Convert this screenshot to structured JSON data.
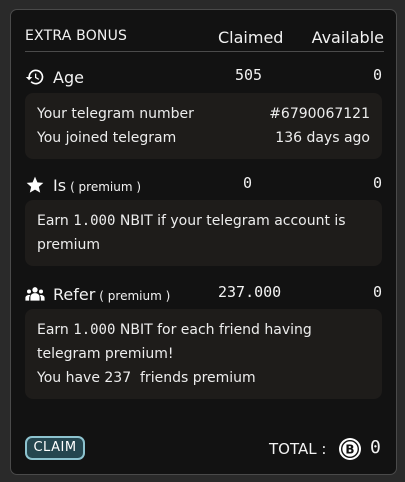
{
  "header": {
    "title": "EXTRA BONUS",
    "claimed_col": "Claimed",
    "available_col": "Available"
  },
  "sections": {
    "age": {
      "icon": "history-icon",
      "label": "Age",
      "claimed": "505",
      "available": "0",
      "rows": [
        {
          "label": "Your telegram number",
          "value": "#6790067121"
        },
        {
          "label": "You joined telegram",
          "value": "136 days ago"
        }
      ]
    },
    "premium": {
      "icon": "star-icon",
      "label": "Is",
      "qualifier": "( premium )",
      "claimed": "0",
      "available": "0",
      "text_pre": "Earn ",
      "text_amount": "1.000",
      "text_post": " NBIT if your telegram account is premium"
    },
    "refer": {
      "icon": "group-icon",
      "label": "Refer",
      "qualifier": "( premium )",
      "claimed": "237.000",
      "available": "0",
      "text_pre": "Earn ",
      "text_amount": "1.000",
      "text_post": " NBIT for each friend having telegram premium!",
      "friends_line": "You have 237  friends premium"
    }
  },
  "footer": {
    "claim_label": "CLAIM",
    "total_label": "TOTAL :",
    "total_value": "0",
    "coin_icon": "bitcoin-coin-icon"
  },
  "colors": {
    "background": "#121212",
    "box": "#1e1c1a",
    "claim_border": "#8dc3cf",
    "claim_fill": "#25464f"
  }
}
